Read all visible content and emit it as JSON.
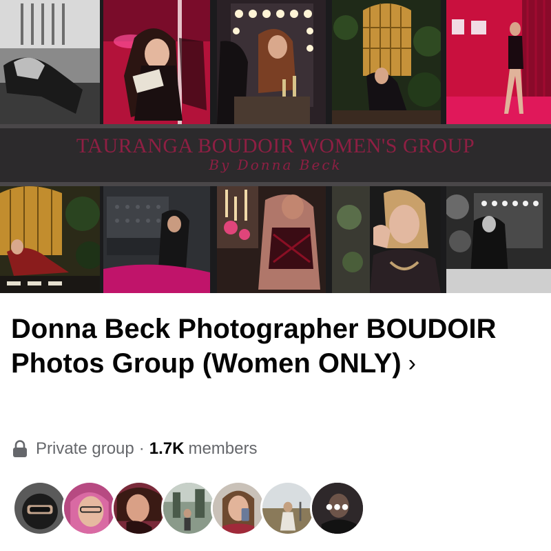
{
  "cover": {
    "banner_title": "TAURANGA BOUDOIR WOMEN'S GROUP",
    "banner_subtitle": "By Donna Beck"
  },
  "group": {
    "name": "Donna Beck Photographer BOUDOIR Photos Group (Women ONLY)",
    "chevron": "›",
    "privacy": "Private group",
    "separator": "·",
    "member_count": "1.7K",
    "members_label": "members"
  },
  "members": {
    "more_label": "•••",
    "avatar_count": 7
  },
  "colors": {
    "banner_text": "#8e1f43",
    "banner_bg": "#2c2a2c",
    "meta_text": "#65676b",
    "title_text": "#050505"
  }
}
